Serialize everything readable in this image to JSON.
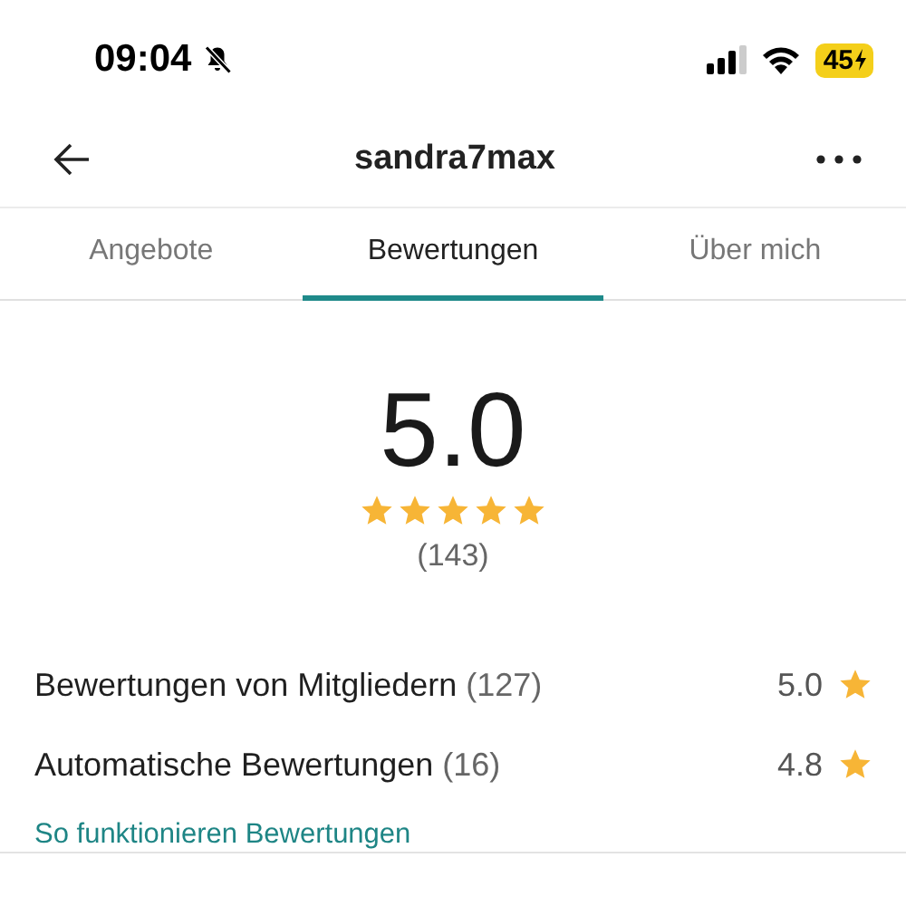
{
  "status_bar": {
    "time": "09:04",
    "battery": "45"
  },
  "header": {
    "title": "sandra7max"
  },
  "tabs": [
    {
      "label": "Angebote",
      "selected": false
    },
    {
      "label": "Bewertungen",
      "selected": true
    },
    {
      "label": "Über mich",
      "selected": false
    }
  ],
  "summary": {
    "score": "5.0",
    "stars": 5,
    "count": "(143)"
  },
  "breakdown": [
    {
      "label": "Bewertungen von Mitgliedern",
      "count": "(127)",
      "score": "5.0"
    },
    {
      "label": "Automatische Bewertungen",
      "count": "(16)",
      "score": "4.8"
    }
  ],
  "link": "So funktionieren Bewertungen"
}
